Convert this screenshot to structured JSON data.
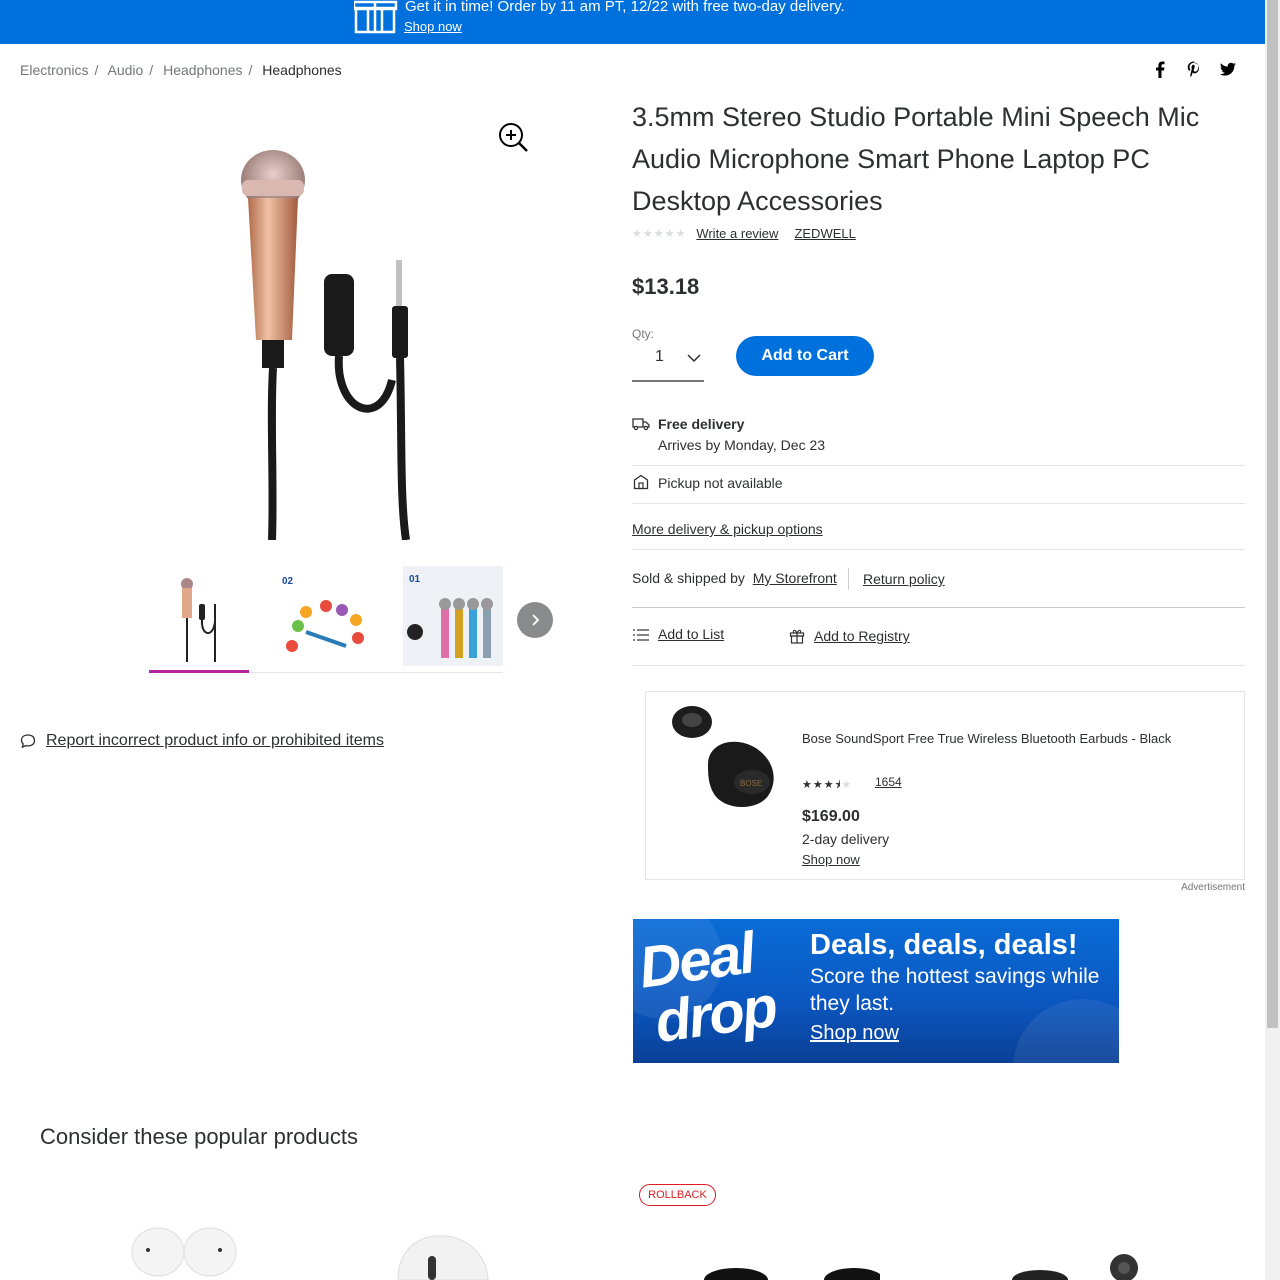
{
  "banner": {
    "message": "Get it in time! Order by 11 am PT, 12/22 with free two-day delivery.",
    "link": "Shop now"
  },
  "breadcrumb": [
    "Electronics",
    "Audio",
    "Headphones",
    "Headphones"
  ],
  "social": [
    "facebook-icon",
    "pinterest-icon",
    "twitter-icon"
  ],
  "product": {
    "title": "3.5mm Stereo Studio Portable Mini Speech Mic Audio Microphone Smart Phone Laptop PC Desktop Accessories",
    "rating_stars": 0,
    "write_review": "Write a review",
    "brand": "ZEDWELL",
    "price": "$13.18",
    "qty_label": "Qty:",
    "qty_value": "1",
    "add_to_cart": "Add to Cart"
  },
  "fulfillment": {
    "delivery_title": "Free delivery",
    "delivery_sub": "Arrives by Monday, Dec 23",
    "pickup": "Pickup not available",
    "more_options": "More delivery & pickup options",
    "sold_by_label": "Sold & shipped by",
    "seller": "My Storefront",
    "return_policy": "Return policy",
    "add_to_list": "Add to List",
    "add_to_registry": "Add to Registry"
  },
  "report": "Report incorrect product info or prohibited items",
  "ad": {
    "name": "Bose SoundSport Free True Wireless Bluetooth Earbuds - Black",
    "rating": 3.5,
    "review_count": "1654",
    "price": "$169.00",
    "delivery": "2-day delivery",
    "link": "Shop now",
    "label": "Advertisement"
  },
  "deal_banner": {
    "word1": "Deal",
    "word2": "drop",
    "headline": "Deals, deals, deals!",
    "sub": "Score the hottest savings while they last.",
    "link": "Shop now"
  },
  "section_title": "Consider these popular products",
  "rollback_badge": "ROLLBACK",
  "colors": {
    "primary": "#0071dc",
    "accent": "#b5249c",
    "rollback": "#de1c24"
  }
}
